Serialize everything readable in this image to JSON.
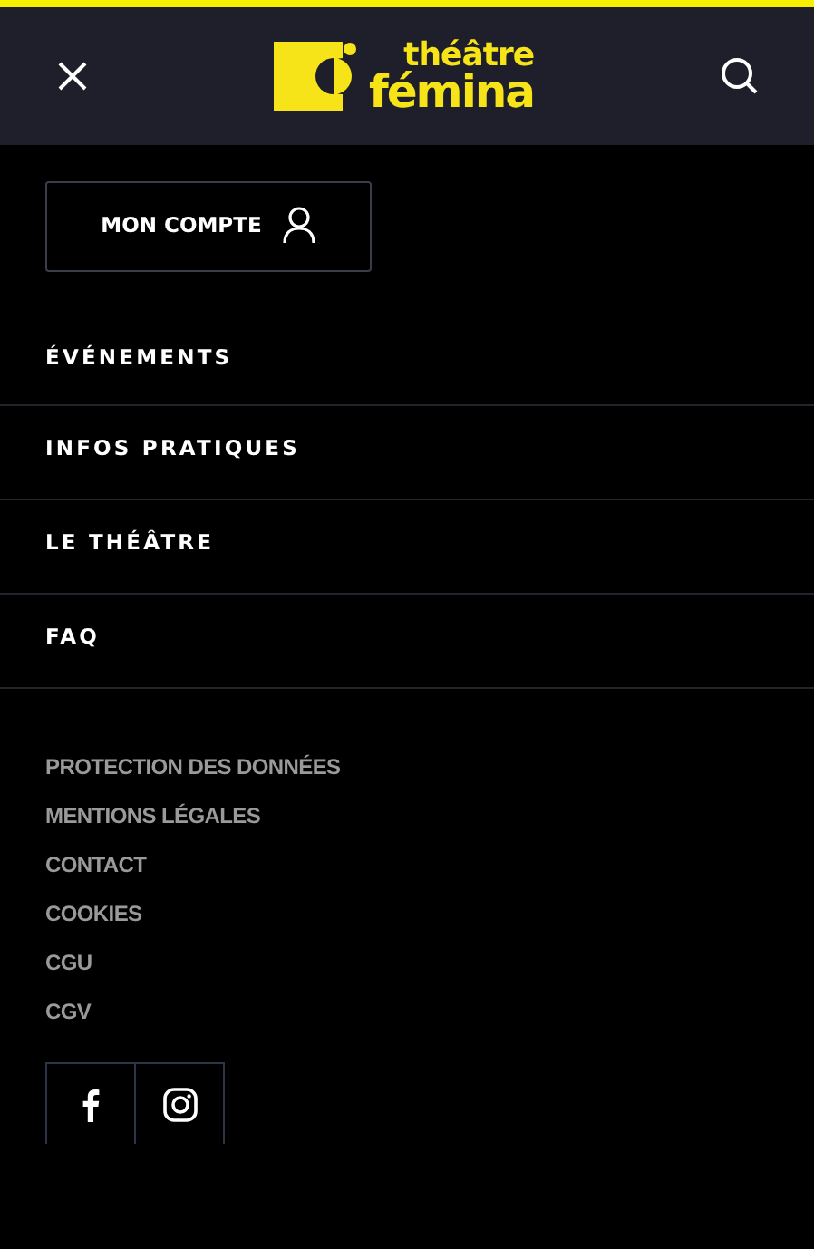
{
  "header": {
    "logo": {
      "top": "théâtre",
      "bottom": "fémina"
    }
  },
  "account_button": {
    "label": "MON COMPTE"
  },
  "nav": [
    {
      "label": "ÉVÉNEMENTS"
    },
    {
      "label": "INFOS PRATIQUES"
    },
    {
      "label": "LE THÉÂTRE"
    },
    {
      "label": "FAQ"
    }
  ],
  "footer_links": [
    "PROTECTION DES DONNÉES",
    "MENTIONS LÉGALES",
    "CONTACT",
    "COOKIES",
    "CGU",
    "CGV"
  ],
  "social": [
    {
      "kind": "facebook"
    },
    {
      "kind": "instagram"
    }
  ]
}
